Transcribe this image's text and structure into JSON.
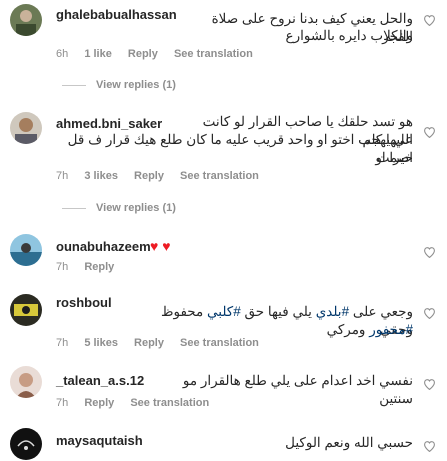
{
  "comments": [
    {
      "username": "ghalebabualhassan",
      "text_line1": "والحل يعني كيف بدنا نروح على صلاة الفجر",
      "text_line2": "والكلاب دايره بالشوارع",
      "time": "6h",
      "likes": "1 like",
      "reply": "Reply",
      "see_translation": "See translation",
      "view_replies": "View replies (1)"
    },
    {
      "username": "ahmed.bni_saker",
      "text_line1": "هو تسد حلقك يا صاحب القرار لو كانت الي يهجم",
      "text_line2": "عليها كلب اختو او واحد قريب عليه ما كان طلع هيك قرار ف قل خيرا او",
      "text_line3": "اصمت",
      "time": "7h",
      "likes": "3 likes",
      "reply": "Reply",
      "see_translation": "See translation",
      "view_replies": "View replies (1)"
    },
    {
      "username": "ounabuhazeem",
      "text": "♥ ♥",
      "time": "7h",
      "reply": "Reply"
    },
    {
      "username": "roshboul",
      "text_part1": "وجعي على ",
      "hashtag1": "#بلدي",
      "text_part2": " يلي فيها حق ",
      "hashtag2": "#كلبي",
      "text_part3": " محفوظ وحقي",
      "hashtag3": "#محفور",
      "text_part4": " ومركي",
      "time": "7h",
      "likes": "5 likes",
      "reply": "Reply",
      "see_translation": "See translation"
    },
    {
      "username": "_talean_a.s.12",
      "text": "نفسي اخد اعدام على يلي طلع هالقرار مو سنتين",
      "time": "7h",
      "reply": "Reply",
      "see_translation": "See translation"
    },
    {
      "username": "maysaqutaish",
      "text": "حسبي الله ونعم الوكيل"
    }
  ],
  "colors": {
    "text": "#262626",
    "muted": "#8e8e8e",
    "hashtag": "#00376b",
    "heart": "#ed1c24"
  }
}
